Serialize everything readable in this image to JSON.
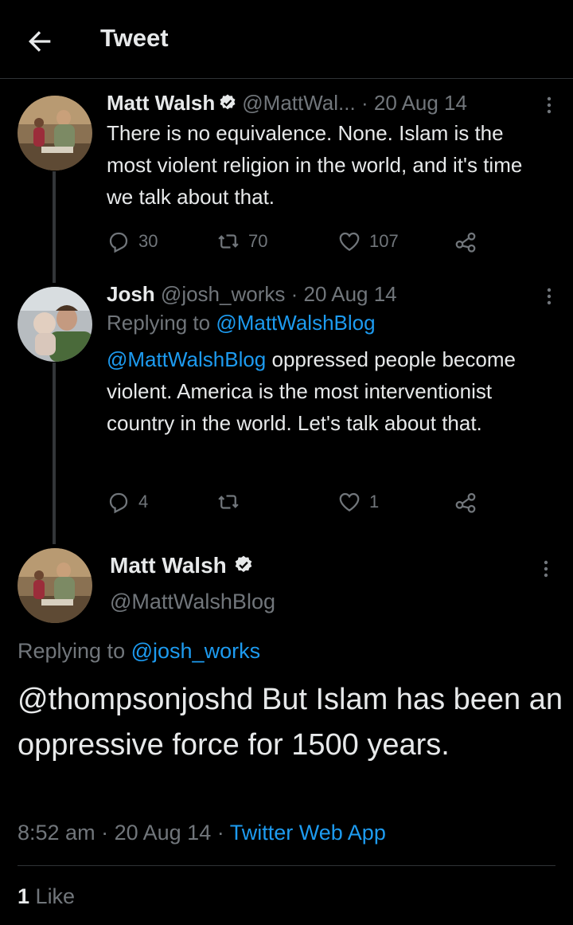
{
  "header": {
    "title": "Tweet"
  },
  "tweet1": {
    "name": "Matt Walsh",
    "handle": "@MattWal...",
    "sep": "·",
    "date": "20 Aug 14",
    "text": "There is no equivalence. None. Islam is the most violent religion in the world, and it's time we talk about that.",
    "replies": "30",
    "retweets": "70",
    "likes": "107"
  },
  "tweet2": {
    "name": "Josh",
    "handle": "@josh_works",
    "sep": "·",
    "date": "20 Aug 14",
    "replying_label": "Replying to",
    "replying_to": "@MattWalshBlog",
    "mention": "@MattWalshBlog",
    "text": " oppressed people become violent. America is the most interventionist country in the world. Let's talk about that.",
    "replies": "4",
    "retweets": "",
    "likes": "1"
  },
  "main": {
    "name": "Matt Walsh",
    "handle": "@MattWalshBlog",
    "replying_label": "Replying to",
    "replying_to": "@josh_works",
    "text": "@thompsonjoshd But Islam has been an oppressive force for 1500 years.",
    "time": "8:52 am",
    "sep1": "·",
    "date": "20 Aug 14",
    "sep2": "·",
    "source": "Twitter Web App",
    "like_count": "1",
    "like_label": "Like"
  },
  "colors": {
    "background": "#000000",
    "text": "#e7e9ea",
    "muted": "#71767b",
    "link": "#1d9bf0",
    "border": "#2f3336"
  },
  "icons": [
    "back-arrow-icon",
    "verified-badge-icon",
    "more-icon",
    "reply-icon",
    "retweet-icon",
    "like-icon",
    "share-icon",
    "avatar"
  ]
}
